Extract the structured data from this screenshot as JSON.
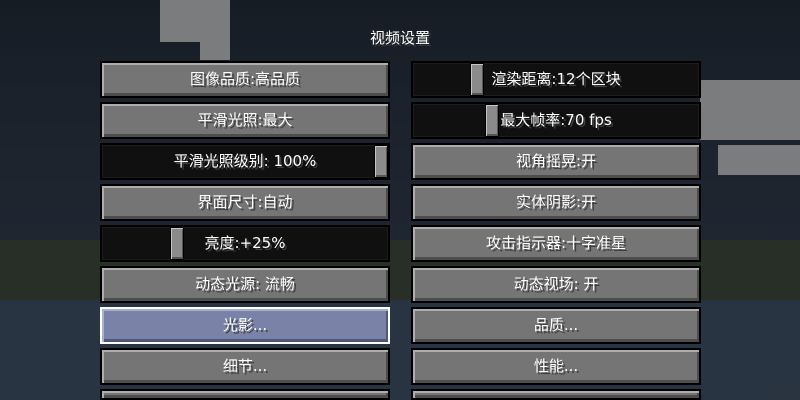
{
  "screen": {
    "title": "视频设置"
  },
  "left_column": [
    {
      "kind": "button",
      "label": "图像品质:高品质"
    },
    {
      "kind": "button",
      "label": "平滑光照:最大"
    },
    {
      "kind": "slider",
      "label": "平滑光照级别: 100%",
      "value_fraction": 1.0
    },
    {
      "kind": "button",
      "label": "界面尺寸:自动"
    },
    {
      "kind": "slider",
      "label": "亮度:+25%",
      "value_fraction": 0.25
    },
    {
      "kind": "button",
      "label": "动态光源: 流畅"
    },
    {
      "kind": "button",
      "label": "光影...",
      "state": "hovered"
    },
    {
      "kind": "button",
      "label": "细节..."
    },
    {
      "kind": "button",
      "label": "",
      "note": "partially cut off"
    }
  ],
  "right_column": [
    {
      "kind": "slider",
      "label": "渲染距离:12个区块",
      "value_fraction": 0.34
    },
    {
      "kind": "slider",
      "label": "最大帧率:70 fps",
      "value_fraction": 0.25
    },
    {
      "kind": "button",
      "label": "视角摇晃:开"
    },
    {
      "kind": "button",
      "label": "实体阴影:开"
    },
    {
      "kind": "button",
      "label": "攻击指示器:十字准星"
    },
    {
      "kind": "button",
      "label": "动态视场: 开"
    },
    {
      "kind": "button",
      "label": "品质..."
    },
    {
      "kind": "button",
      "label": "性能..."
    },
    {
      "kind": "button",
      "label": "",
      "note": "partially cut off"
    }
  ],
  "colors": {
    "button_face": "#757575",
    "button_hover": "#7b82a8",
    "slider_track": "#101010",
    "text": "#ffffff"
  }
}
